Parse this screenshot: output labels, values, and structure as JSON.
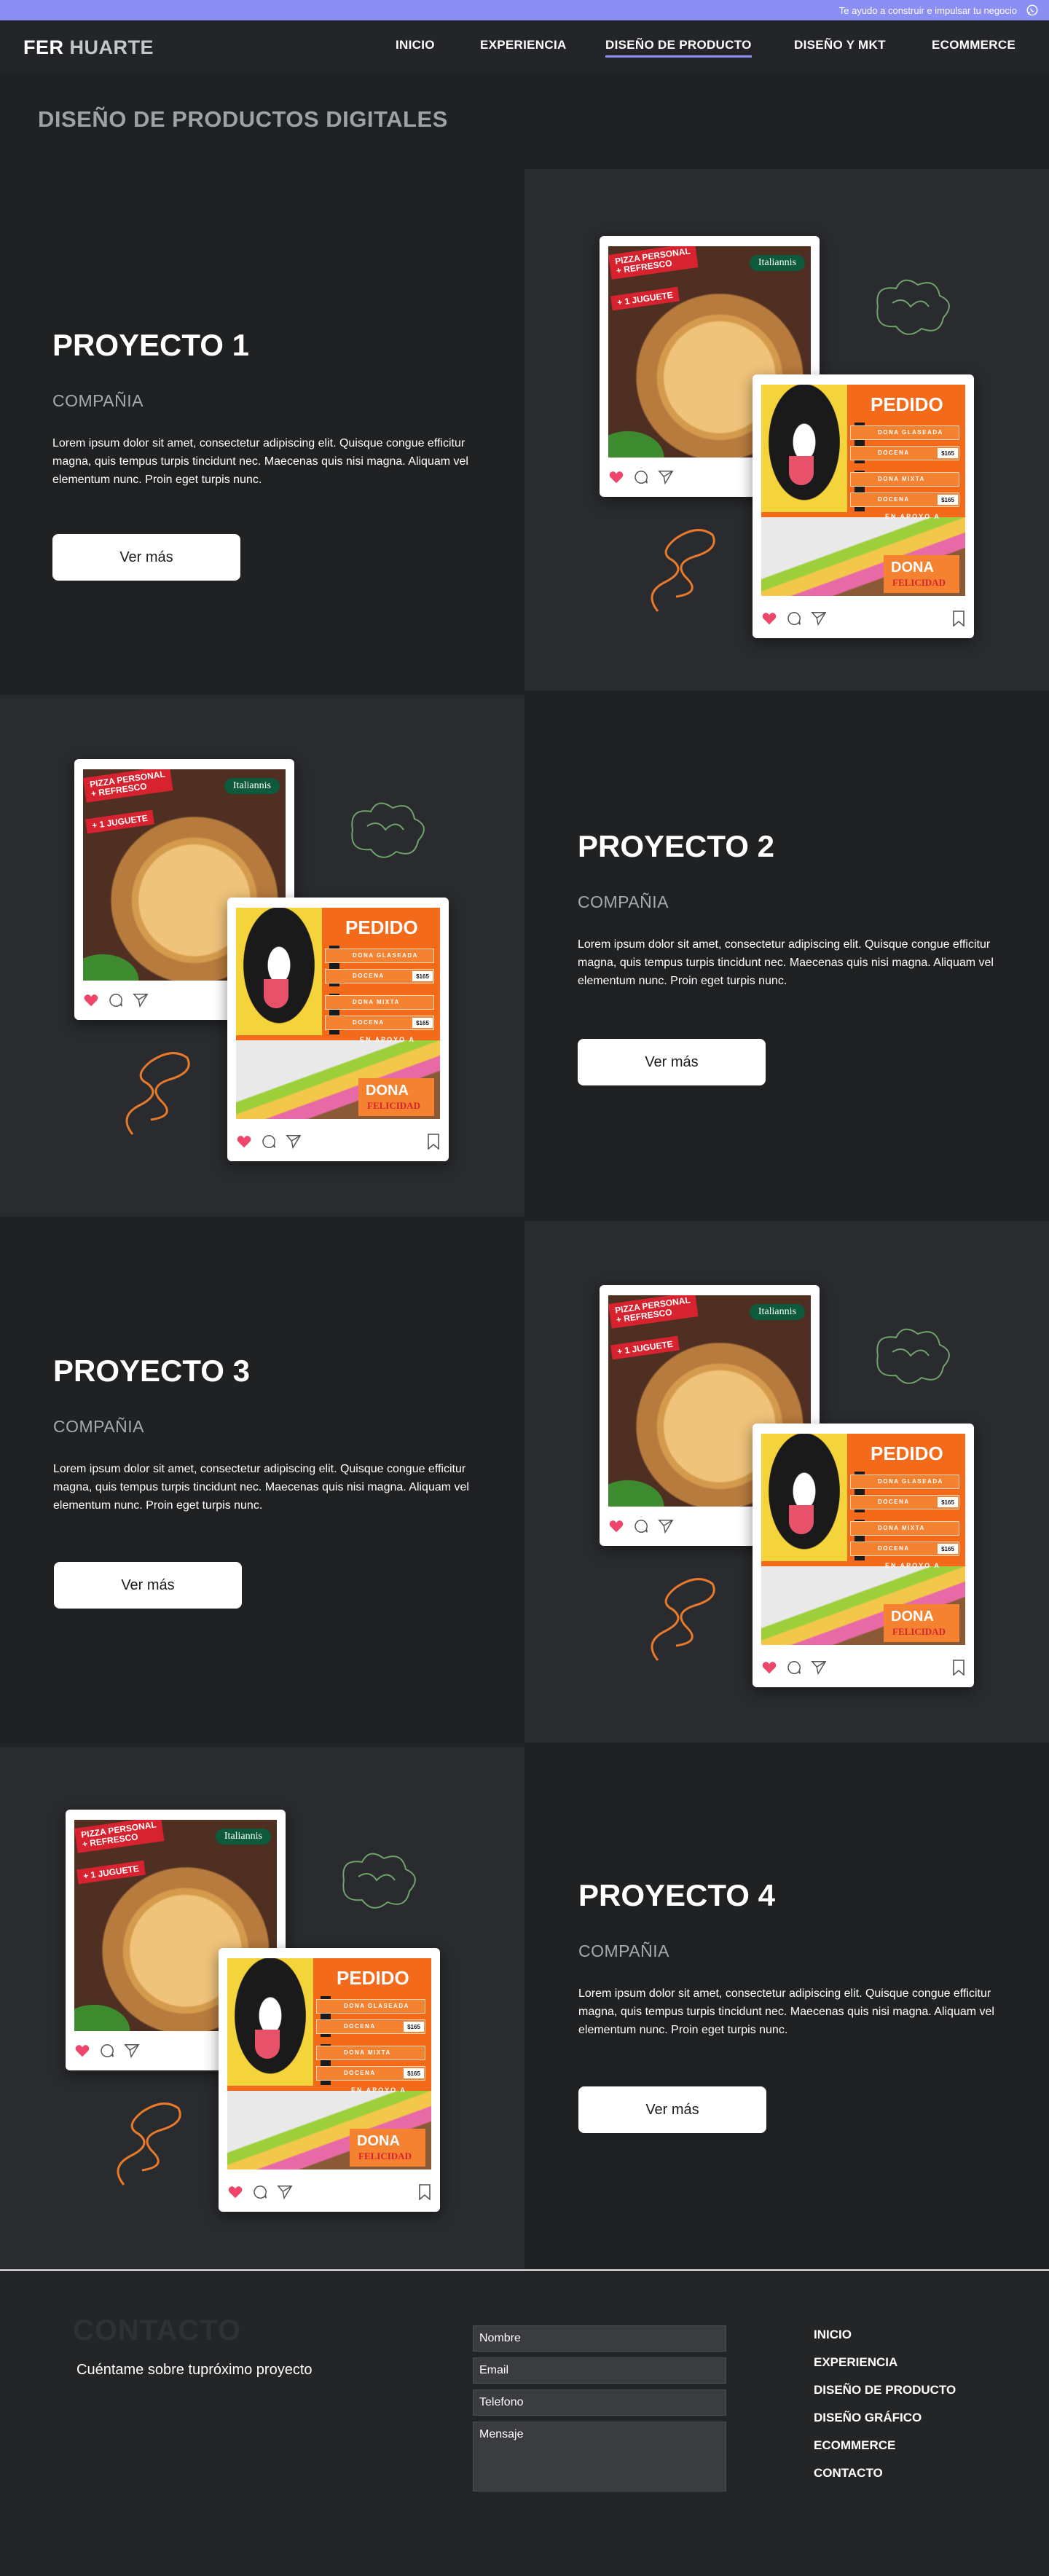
{
  "topbar": {
    "text": "Te ayudo a construir e impulsar tu negocio",
    "icon": "whatsapp-icon",
    "color": "#8b8ef2"
  },
  "header": {
    "logo_first": "FER",
    "logo_second": "HUARTE",
    "nav": [
      {
        "label": "INICIO"
      },
      {
        "label": "EXPERIENCIA"
      },
      {
        "label": "DISEÑO DE PRODUCTO",
        "active": true
      },
      {
        "label": "DISEÑO Y MKT"
      },
      {
        "label": "ECOMMERCE"
      }
    ]
  },
  "page_title": "DISEÑO DE PRODUCTOS DIGITALES",
  "mockup": {
    "pizza_badge_line1": "PIZZA PERSONAL",
    "pizza_badge_line2": "+ REFRESCO",
    "pizza_badge_line3": "+ 1 JUGUETE",
    "pizza_brand": "Italiannis",
    "order_title": "PEDIDO",
    "order_item1": "DONA GLASEADA",
    "order_item2": "DOCENA",
    "order_item3": "DONA MIXTA",
    "order_item4": "DOCENA",
    "order_price": "$165",
    "order_support": "EN APOYO A",
    "order_tag_title": "DONA",
    "order_tag_sub": "FELICIDAD",
    "icons": [
      "heart-icon",
      "comment-icon",
      "send-icon",
      "bookmark-icon"
    ]
  },
  "projects": [
    {
      "title": "PROYECTO 1",
      "company": "COMPAÑIA",
      "description": "Lorem ipsum dolor sit amet, consectetur adipiscing elit. Quisque congue efficitur magna, quis tempus turpis tincidunt nec. Maecenas quis nisi magna. Aliquam vel elementum nunc. Proin eget turpis nunc.",
      "button": "Ver más"
    },
    {
      "title": "PROYECTO 2",
      "company": "COMPAÑIA",
      "description": "Lorem ipsum dolor sit amet, consectetur adipiscing elit. Quisque congue efficitur magna, quis tempus turpis tincidunt nec. Maecenas quis nisi magna. Aliquam vel elementum nunc. Proin eget turpis nunc.",
      "button": "Ver más"
    },
    {
      "title": "PROYECTO 3",
      "company": "COMPAÑIA",
      "description": "Lorem ipsum dolor sit amet, consectetur adipiscing elit. Quisque congue efficitur magna, quis tempus turpis tincidunt nec. Maecenas quis nisi magna. Aliquam vel elementum nunc. Proin eget turpis nunc.",
      "button": "Ver más"
    },
    {
      "title": "PROYECTO 4",
      "company": "COMPAÑIA",
      "description": "Lorem ipsum dolor sit amet, consectetur adipiscing elit. Quisque congue efficitur magna, quis tempus turpis tincidunt nec. Maecenas quis nisi magna. Aliquam vel elementum nunc. Proin eget turpis nunc.",
      "button": "Ver más"
    }
  ],
  "footer": {
    "title": "CONTACTO",
    "subtitle": "Cuéntame sobre tupróximo proyecto",
    "fields": {
      "name": "Nombre",
      "email": "Email",
      "phone": "Telefono",
      "message": "Mensaje"
    },
    "links": [
      "INICIO",
      "EXPERIENCIA",
      "DISEÑO DE PRODUCTO",
      "DISEÑO GRÁFICO",
      "ECOMMERCE",
      "CONTACTO"
    ]
  }
}
